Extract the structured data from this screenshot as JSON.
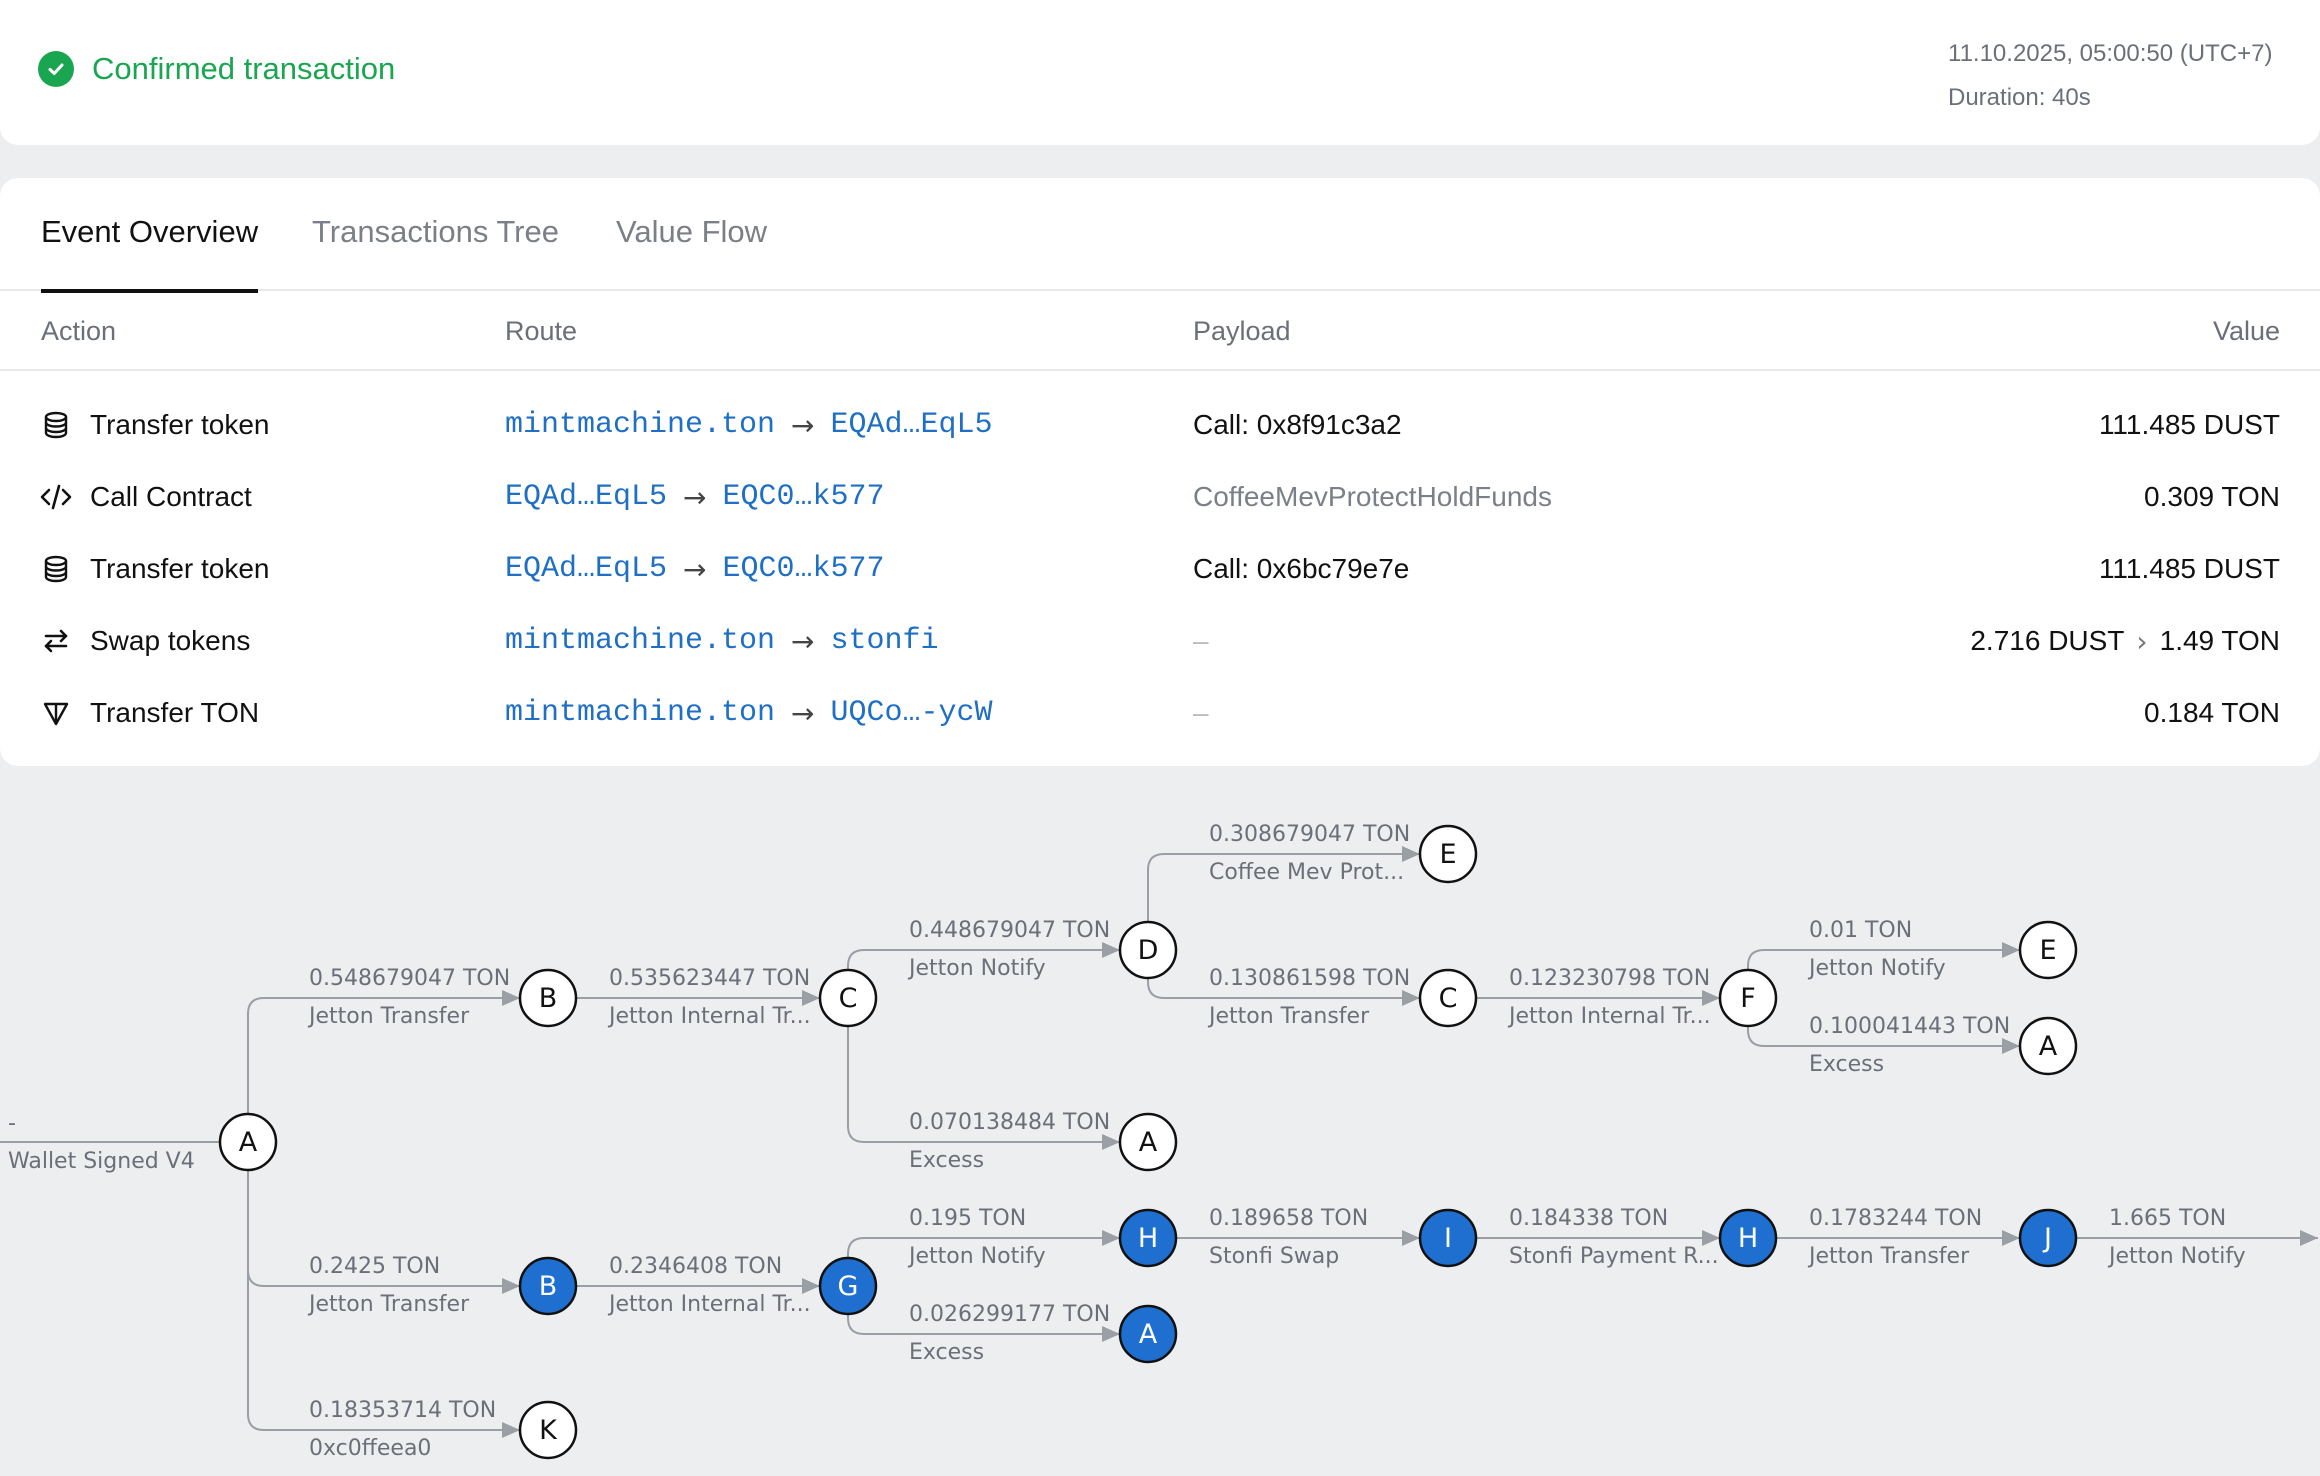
{
  "status": {
    "title": "Confirmed transaction",
    "datetime": "11.10.2025, 05:00:50 (UTC+7)",
    "duration": "Duration: 40s",
    "color": "#1aa651"
  },
  "tabs": [
    {
      "label": "Event Overview",
      "active": true
    },
    {
      "label": "Transactions Tree",
      "active": false
    },
    {
      "label": "Value Flow",
      "active": false
    }
  ],
  "table": {
    "headers": {
      "action": "Action",
      "route": "Route",
      "payload": "Payload",
      "value": "Value"
    },
    "rows": [
      {
        "icon": "coins-stack-icon",
        "action": "Transfer token",
        "from": "mintmachine.ton",
        "to": "EQAd…EqL5",
        "payload": "Call: 0x8f91c3a2",
        "value": "111.485 DUST"
      },
      {
        "icon": "code-icon",
        "action": "Call Contract",
        "from": "EQAd…EqL5",
        "to": "EQC0…k577",
        "payload": "CoffeeMevProtectHoldFunds",
        "value": "0.309 TON"
      },
      {
        "icon": "coins-stack-icon",
        "action": "Transfer token",
        "from": "EQAd…EqL5",
        "to": "EQC0…k577",
        "payload": "Call: 0x6bc79e7e",
        "value": "111.485 DUST"
      },
      {
        "icon": "swap-icon",
        "action": "Swap tokens",
        "from": "mintmachine.ton",
        "to": "stonfi",
        "payload": "–",
        "value_from": "2.716 DUST",
        "value_to": "1.49 TON"
      },
      {
        "icon": "ton-diamond-icon",
        "action": "Transfer TON",
        "from": "mintmachine.ton",
        "to": "UQCo…-ycW",
        "payload": "–",
        "value": "0.184 TON"
      }
    ]
  },
  "graph": {
    "accent": "#1f6fd0",
    "root_edge": {
      "amount": "-",
      "label": "Wallet Signed V4"
    },
    "nodes": [
      {
        "id": "nA0",
        "letter": "A",
        "filled": false
      },
      {
        "id": "nB1",
        "letter": "B",
        "filled": false
      },
      {
        "id": "nC1",
        "letter": "C",
        "filled": false
      },
      {
        "id": "nD1",
        "letter": "D",
        "filled": false
      },
      {
        "id": "nE1",
        "letter": "E",
        "filled": false
      },
      {
        "id": "nC2",
        "letter": "C",
        "filled": false
      },
      {
        "id": "nF1",
        "letter": "F",
        "filled": false
      },
      {
        "id": "nE2",
        "letter": "E",
        "filled": false
      },
      {
        "id": "nA2",
        "letter": "A",
        "filled": false
      },
      {
        "id": "nA1",
        "letter": "A",
        "filled": false
      },
      {
        "id": "nB2",
        "letter": "B",
        "filled": true
      },
      {
        "id": "nG1",
        "letter": "G",
        "filled": true
      },
      {
        "id": "nH1",
        "letter": "H",
        "filled": true
      },
      {
        "id": "nI1",
        "letter": "I",
        "filled": true
      },
      {
        "id": "nH2",
        "letter": "H",
        "filled": true
      },
      {
        "id": "nJ1",
        "letter": "J",
        "filled": true
      },
      {
        "id": "nA3",
        "letter": "A",
        "filled": true
      },
      {
        "id": "nK1",
        "letter": "K",
        "filled": false
      }
    ],
    "edges": [
      {
        "from": "nA0",
        "to": "nB1",
        "amount": "0.548679047 TON",
        "label": "Jetton Transfer"
      },
      {
        "from": "nB1",
        "to": "nC1",
        "amount": "0.535623447 TON",
        "label": "Jetton Internal Tr..."
      },
      {
        "from": "nC1",
        "to": "nD1",
        "amount": "0.448679047 TON",
        "label": "Jetton Notify"
      },
      {
        "from": "nD1",
        "to": "nE1",
        "amount": "0.308679047 TON",
        "label": "Coffee Mev Prot..."
      },
      {
        "from": "nD1",
        "to": "nC2",
        "amount": "0.130861598 TON",
        "label": "Jetton Transfer"
      },
      {
        "from": "nC2",
        "to": "nF1",
        "amount": "0.123230798 TON",
        "label": "Jetton Internal Tr..."
      },
      {
        "from": "nF1",
        "to": "nE2",
        "amount": "0.01 TON",
        "label": "Jetton Notify"
      },
      {
        "from": "nF1",
        "to": "nA2",
        "amount": "0.100041443 TON",
        "label": "Excess"
      },
      {
        "from": "nC1",
        "to": "nA1",
        "amount": "0.070138484 TON",
        "label": "Excess"
      },
      {
        "from": "nA0",
        "to": "nB2",
        "amount": "0.2425 TON",
        "label": "Jetton Transfer"
      },
      {
        "from": "nB2",
        "to": "nG1",
        "amount": "0.2346408 TON",
        "label": "Jetton Internal Tr..."
      },
      {
        "from": "nG1",
        "to": "nH1",
        "amount": "0.195 TON",
        "label": "Jetton Notify"
      },
      {
        "from": "nH1",
        "to": "nI1",
        "amount": "0.189658 TON",
        "label": "Stonfi Swap"
      },
      {
        "from": "nI1",
        "to": "nH2",
        "amount": "0.184338 TON",
        "label": "Stonfi Payment R..."
      },
      {
        "from": "nH2",
        "to": "nJ1",
        "amount": "0.1783244 TON",
        "label": "Jetton Transfer"
      },
      {
        "from": "nJ1",
        "to": "out",
        "amount": "1.665 TON",
        "label": "Jetton Notify"
      },
      {
        "from": "nG1",
        "to": "nA3",
        "amount": "0.026299177 TON",
        "label": "Excess"
      },
      {
        "from": "nA0",
        "to": "nK1",
        "amount": "0.18353714 TON",
        "label": "0xc0ffeea0"
      }
    ]
  }
}
